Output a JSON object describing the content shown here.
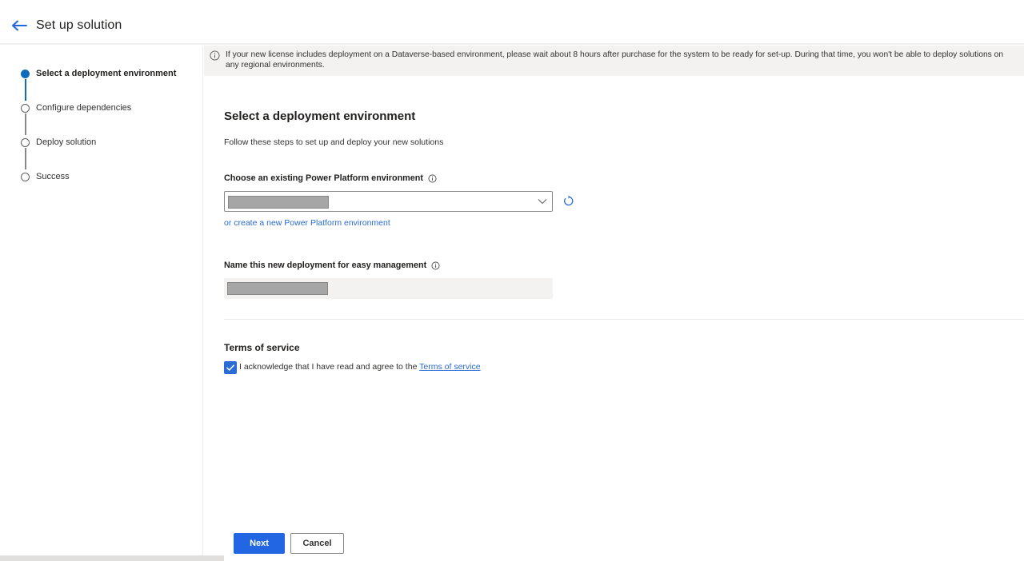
{
  "header": {
    "title": "Set up solution",
    "back_icon": "arrow-left-icon"
  },
  "sidebar": {
    "steps": [
      {
        "label": "Select a deployment environment",
        "state": "active"
      },
      {
        "label": "Configure dependencies",
        "state": "pending"
      },
      {
        "label": "Deploy solution",
        "state": "pending"
      },
      {
        "label": "Success",
        "state": "pending"
      }
    ]
  },
  "banner": {
    "icon": "info-icon",
    "text": "If your new license includes deployment on a Dataverse-based environment, please wait about 8 hours after purchase for the system to be ready for set-up. During that time, you won't be able to deploy solutions on any regional environments."
  },
  "main": {
    "title": "Select a deployment environment",
    "subtitle": "Follow these steps to set up and deploy your new solutions",
    "environment": {
      "label": "Choose an existing Power Platform environment",
      "value": "[redacted]",
      "create_link": "or create a new Power Platform environment"
    },
    "deployment_name": {
      "label": "Name this new deployment for easy management",
      "value": "[redacted]"
    },
    "terms": {
      "title": "Terms of service",
      "checked": true,
      "text": "I acknowledge that I have read and agree to the ",
      "link": "Terms of service"
    }
  },
  "footer": {
    "next_label": "Next",
    "cancel_label": "Cancel"
  },
  "colors": {
    "accent": "#2266e3",
    "link": "#2a6bd6",
    "step_active": "#0f6cbd",
    "banner_bg": "#f3f2f1"
  }
}
